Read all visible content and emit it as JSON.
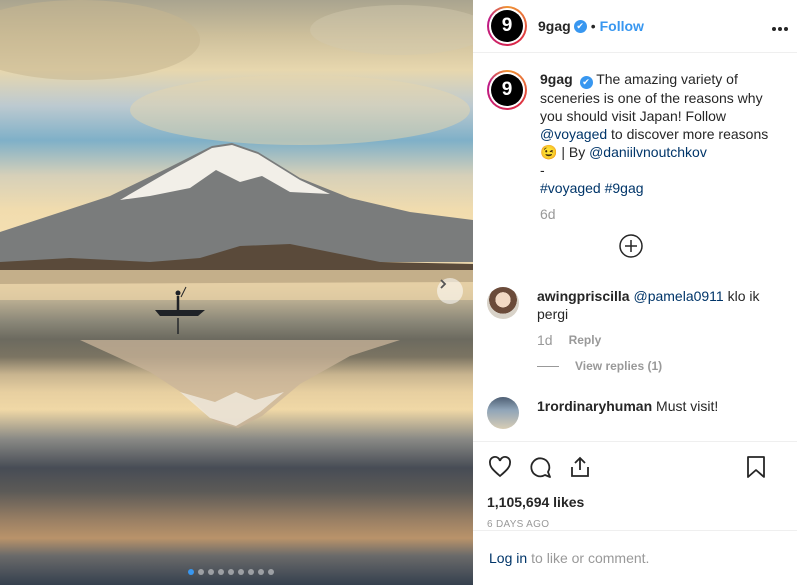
{
  "post": {
    "username": "9gag",
    "avatar_text": "9",
    "follow_label": "Follow",
    "bullet": "•",
    "more_icon": "more-options-icon",
    "verified_mark": "✔",
    "next_icon": "chevron-right-icon",
    "carousel": {
      "count": 9,
      "active_index": 0
    }
  },
  "caption": {
    "username": "9gag",
    "text_before": "The amazing variety of sceneries is one of the reasons why you should visit Japan! Follow",
    "mention_1": "@voyaged",
    "text_middle": "to discover more reasons",
    "emoji": "😉",
    "text_by": "| By",
    "mention_2": "@daniilvnoutchkov",
    "dash": "-",
    "hashtags": [
      "#voyaged",
      "#9gag"
    ],
    "age": "6d"
  },
  "load_more_icon": "plus-circle-icon",
  "comments": [
    {
      "username": "awingpriscilla",
      "mention": "@pamela0911",
      "text": "klo ik pergi",
      "time": "1d",
      "reply_label": "Reply",
      "view_replies": "View replies (1)"
    },
    {
      "username": "1rordinaryhuman",
      "text": "Must visit!"
    }
  ],
  "actions": {
    "likes": "1,105,694 likes",
    "date": "6 DAYS AGO",
    "icons": [
      "heart-icon",
      "comment-icon",
      "share-icon",
      "bookmark-icon"
    ]
  },
  "login": {
    "link": "Log in",
    "text": "to like or comment."
  },
  "colors": {
    "accent": "#3897f0",
    "link": "#003569",
    "muted": "#999999"
  }
}
